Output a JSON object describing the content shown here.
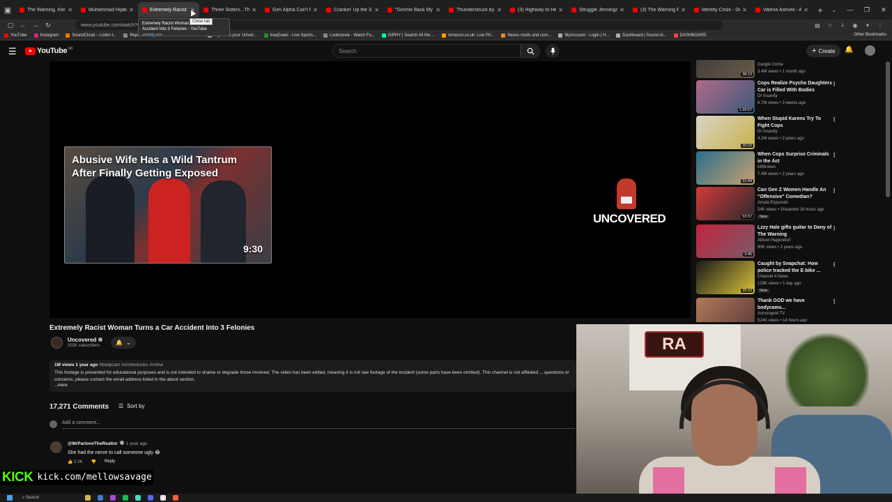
{
  "browser": {
    "tabs": [
      {
        "title": "The Warning, Kerosen",
        "active": false
      },
      {
        "title": "Muhammad Hijab Sn",
        "active": false
      },
      {
        "title": "Extremely Racist Wo",
        "active": true
      },
      {
        "title": "Three Sisters...The Gr",
        "active": false
      },
      {
        "title": "Gen Alpha Can't Read",
        "active": false
      },
      {
        "title": "Crankin' Up the 3-Stri",
        "active": false
      },
      {
        "title": "\"Gimme Back My Bull",
        "active": false
      },
      {
        "title": "Thunderstruck by Ste",
        "active": false
      },
      {
        "title": "(3) Highway to Hell, A",
        "active": false
      },
      {
        "title": "Struggle Jennings & C",
        "active": false
      },
      {
        "title": "(3) The Warning Reac",
        "active": false
      },
      {
        "title": "Identity Crisis - Destr",
        "active": false
      },
      {
        "title": "Valeria Ashveil - Ashe",
        "active": false
      }
    ],
    "url": "www.youtube.com/watch?v=...",
    "tooltip_title": "Extremely Racist Woman Turns a Car Accident Into 3 Felonies - YouTube",
    "tooltip_domain": "youtube.com",
    "close_tab_tip": "Close tab",
    "bookmarks": [
      {
        "label": "YouTube",
        "color": "#ff0000"
      },
      {
        "label": "Instagram",
        "color": "#d62976"
      },
      {
        "label": "SoundCloud – Listen t...",
        "color": "#ff7700"
      },
      {
        "label": "Repack",
        "color": "#888888"
      },
      {
        "label": "Halifax - Welcome to ...",
        "color": "#0050a0"
      },
      {
        "label": "Sign in to your Univer...",
        "color": "#999999"
      },
      {
        "label": "IraqGoals - Live Sports...",
        "color": "#2a8f2a"
      },
      {
        "label": "Lookmovie - Watch Fu...",
        "color": "#888888"
      },
      {
        "label": "GIPHY | Search All the ...",
        "color": "#00ff99"
      },
      {
        "label": "Amazon.co.uk: Low Pri...",
        "color": "#ff9900"
      },
      {
        "label": "Nexus mods and com...",
        "color": "#da8e35"
      },
      {
        "label": "MyAccount - Login | H...",
        "color": "#aaaaaa"
      },
      {
        "label": "Dashboard | Sound Al...",
        "color": "#aaaaaa"
      },
      {
        "label": "DASHBOARD",
        "color": "#e44"
      }
    ],
    "other_bookmarks": "Other Bookmarks"
  },
  "masthead": {
    "logo_text": "YouTube",
    "country_code": "GB",
    "search_placeholder": "Search",
    "create_label": "Create"
  },
  "player": {
    "endcard_title": "Abusive Wife Has a Wild Tantrum After Finally Getting Exposed",
    "endcard_duration": "9:30",
    "channel_logo_text": "UNCOVERED"
  },
  "video": {
    "title": "Extremely Racist Woman Turns a Car Accident Into 3 Felonies",
    "channel": "Uncovered",
    "subscribers": "202K subscribers",
    "views": "1M views",
    "age": "1 year ago",
    "hashtags": "#bodycam #crimestories #crime",
    "description": "This footage is presented for educational purposes and is not intended to shame or degrade those involved. The video has been edited, meaning it is not raw footage of the incident (some parts have been omitted). This channel is not affiliated ... questions or concerns, please contact the email address listed in the about section.",
    "more_label": "...more"
  },
  "comments": {
    "count_label": "17,271 Comments",
    "sort_label": "Sort by",
    "add_placeholder": "Add a comment...",
    "items": [
      {
        "author": "@MrParloveTheRealtor",
        "when": "1 year ago",
        "text": "She had the nerve to call someone ugly 😂",
        "likes": "3.3K",
        "reply": "Reply"
      }
    ]
  },
  "recommendations": [
    {
      "title": "",
      "channel": "Dangle Crime",
      "meta": "3.4M views • 1 month ago",
      "duration": "38:13",
      "colors": [
        "#3a3a3a",
        "#6a5a4a"
      ],
      "new": ""
    },
    {
      "title": "Cops Realize Psycho Daughters Car is Filled With Bodies",
      "channel": "Dr Insanity",
      "meta": "6.7M views • 3 weeks ago",
      "duration": "1:29:57",
      "colors": [
        "#b06a8a",
        "#3a5a7a"
      ],
      "new": ""
    },
    {
      "title": "When Stupid Karens Try To Fight Cops",
      "channel": "Dr Insanity",
      "meta": "4.2M views • 2 years ago",
      "duration": "20:22",
      "colors": [
        "#d8d4c8",
        "#c9b24a"
      ],
      "new": ""
    },
    {
      "title": "When Cops Surprise Criminals in the Act",
      "channel": "MrBroken",
      "meta": "7.4M views • 2 years ago",
      "duration": "31:44",
      "colors": [
        "#2a6e8a",
        "#c8a070"
      ],
      "new": ""
    },
    {
      "title": "Can Gen Z Women Handle An \"Offensive\" Comedian?",
      "channel": "Amala Ekpunobi",
      "meta": "54K views • Streamed 18 hours ago",
      "duration": "53:57",
      "colors": [
        "#d23a3a",
        "#2a2a2a"
      ],
      "new": "New"
    },
    {
      "title": "Lzzy Hale gifts guitar to Dany of The Warning",
      "channel": "Allison Hagendorf",
      "meta": "90K views • 2 years ago",
      "duration": "3:45",
      "colors": [
        "#c2243c",
        "#7a5a6a"
      ],
      "new": ""
    },
    {
      "title": "Caught by Snapchat: How police tracked the E-bike ...",
      "channel": "Channel 4 News",
      "meta": "129K views • 1 day ago",
      "duration": "25:10",
      "colors": [
        "#1a1a1a",
        "#d8c23a"
      ],
      "new": "New"
    },
    {
      "title": "Thank GOD we have bodycams...",
      "channel": "Asmongold TV",
      "meta": "524K views • 14 hours ago",
      "duration": "",
      "colors": [
        "#b27a5a",
        "#5a3a3a"
      ],
      "new": ""
    }
  ],
  "overlay": {
    "kick_logo": "KICK",
    "kick_url": "kick.com/mellowsavage",
    "webcam_sign": "RA"
  },
  "taskbar": {
    "search_label": "Search"
  }
}
